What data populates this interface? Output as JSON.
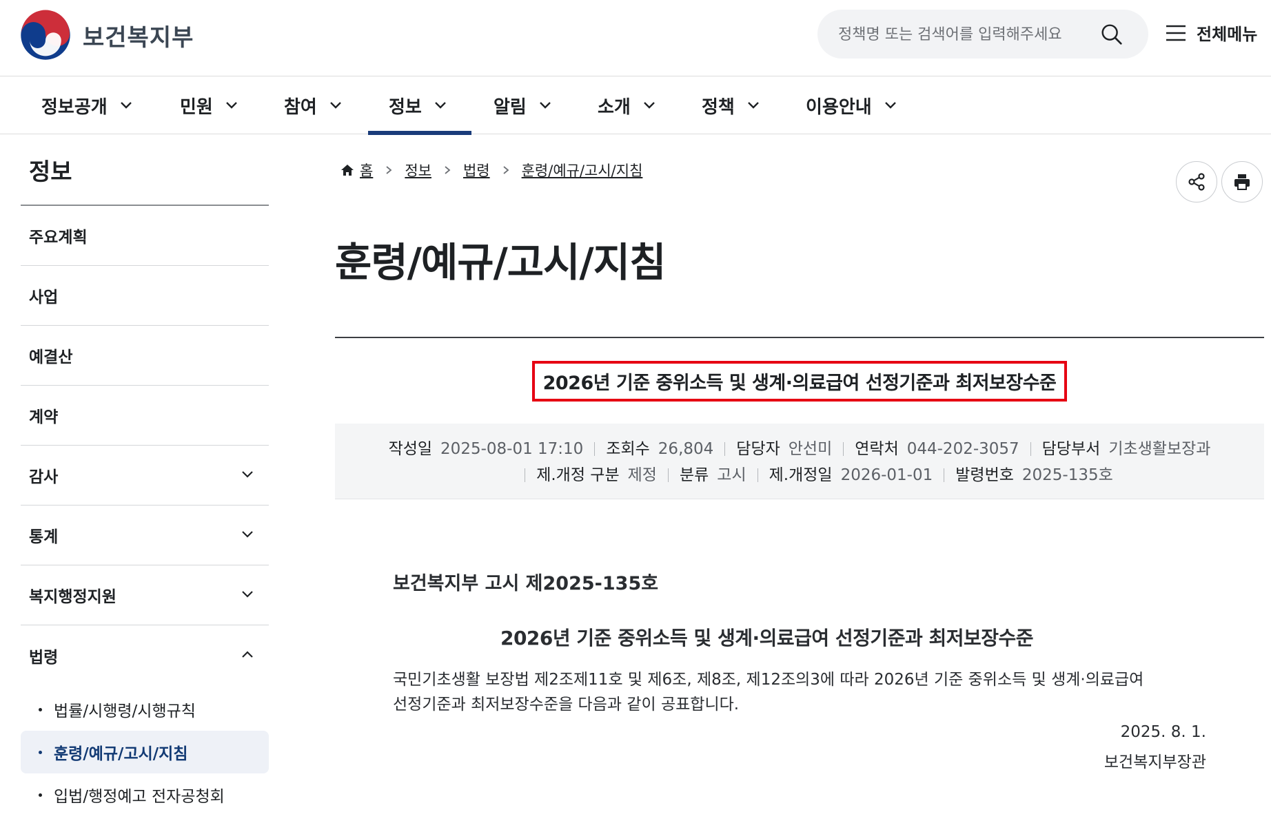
{
  "header": {
    "logo_text": "보건복지부",
    "search_placeholder": "정책명 또는 검색어를 입력해주세요",
    "allmenu_label": "전체메뉴"
  },
  "gnb": {
    "items": [
      {
        "label": "정보공개"
      },
      {
        "label": "민원"
      },
      {
        "label": "참여"
      },
      {
        "label": "정보",
        "active": true
      },
      {
        "label": "알림"
      },
      {
        "label": "소개"
      },
      {
        "label": "정책"
      },
      {
        "label": "이용안내"
      }
    ]
  },
  "lnb": {
    "title": "정보",
    "items": [
      {
        "label": "주요계획"
      },
      {
        "label": "사업"
      },
      {
        "label": "예결산"
      },
      {
        "label": "계약"
      },
      {
        "label": "감사",
        "expandable": true
      },
      {
        "label": "통계",
        "expandable": true
      },
      {
        "label": "복지행정지원",
        "expandable": true
      },
      {
        "label": "법령",
        "expandable": true,
        "expanded": true
      }
    ],
    "sub_items": [
      {
        "label": "법률/시행령/시행규칙"
      },
      {
        "label": "훈령/예규/고시/지침",
        "active": true
      },
      {
        "label": "입법/행정예고 전자공청회"
      }
    ]
  },
  "breadcrumb": {
    "items": [
      "홈",
      "정보",
      "법령",
      "훈령/예규/고시/지침"
    ]
  },
  "page_title": "훈령/예규/고시/지침",
  "post": {
    "title": "2026년 기준 중위소득 및 생계·의료급여 선정기준과 최저보장수준",
    "meta": {
      "row1": [
        {
          "label": "작성일",
          "value": "2025-08-01 17:10"
        },
        {
          "label": "조회수",
          "value": "26,804"
        },
        {
          "label": "담당자",
          "value": "안선미"
        },
        {
          "label": "연락처",
          "value": "044-202-3057"
        },
        {
          "label": "담당부서",
          "value": "기초생활보장과"
        }
      ],
      "row2": [
        {
          "label": "제.개정 구분",
          "value": "제정"
        },
        {
          "label": "분류",
          "value": "고시"
        },
        {
          "label": "제.개정일",
          "value": "2026-01-01"
        },
        {
          "label": "발령번호",
          "value": "2025-135호"
        }
      ]
    },
    "body": {
      "doc_no": "보건복지부 고시 제2025-135호",
      "doc_title": "2026년 기준 중위소득 및 생계·의료급여 선정기준과 최저보장수준",
      "line1": "국민기초생활 보장법 제2조제11호 및 제6조, 제8조, 제12조의3에 따라 2026년 기준 중위소득 및 생계·의료급여",
      "line2": "선정기준과 최저보장수준을 다음과 같이 공표합니다.",
      "date": "2025. 8. 1.",
      "signer": "보건복지부장관"
    }
  },
  "colors": {
    "accent": "#1a3c7a",
    "highlight_border": "#e60012",
    "logo_red": "#cd2e3a",
    "logo_blue": "#0f3c8c"
  },
  "icons": {
    "search": "search-icon",
    "menu": "hamburger-icon",
    "home": "home-icon",
    "share": "share-icon",
    "print": "print-icon"
  }
}
